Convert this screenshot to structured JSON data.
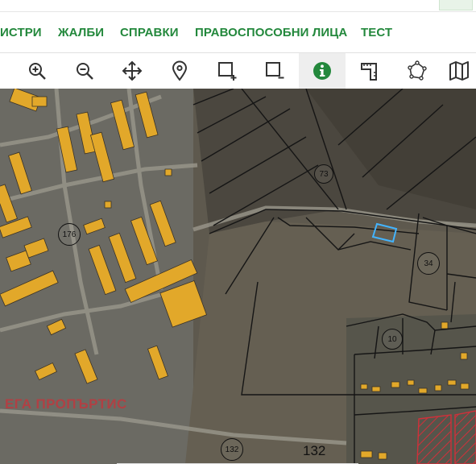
{
  "colors": {
    "brand_green": "#23883c",
    "building_fill": "#e2a82a",
    "parcel_stroke": "#151515",
    "highlight_parcel": "#43b4ff",
    "map_base": "#5b564b",
    "watermark": "#c8333a"
  },
  "nav": {
    "items": [
      {
        "label": "ИСТРИ"
      },
      {
        "label": "ЖАЛБИ"
      },
      {
        "label": "СПРАВКИ"
      },
      {
        "label": "ПРАВОСПОСОБНИ ЛИЦА"
      },
      {
        "label": "ТЕСТ"
      }
    ]
  },
  "toolbar": {
    "tools": [
      {
        "icon": "zoom-in-icon"
      },
      {
        "icon": "zoom-out-icon"
      },
      {
        "icon": "pan-icon"
      },
      {
        "icon": "location-pin-icon"
      },
      {
        "icon": "add-polygon-icon"
      },
      {
        "icon": "remove-polygon-icon"
      },
      {
        "icon": "info-icon",
        "active": true
      },
      {
        "icon": "measure-icon"
      },
      {
        "icon": "draw-shape-icon"
      },
      {
        "icon": "map-layers-icon"
      }
    ]
  },
  "map": {
    "watermark": "ЕГА ПРОПЪРТИС",
    "parcel_labels": {
      "p73": "73",
      "p176": "176",
      "p34": "34",
      "p10": "10",
      "p132_circle": "132",
      "p132_plain": "132"
    }
  }
}
